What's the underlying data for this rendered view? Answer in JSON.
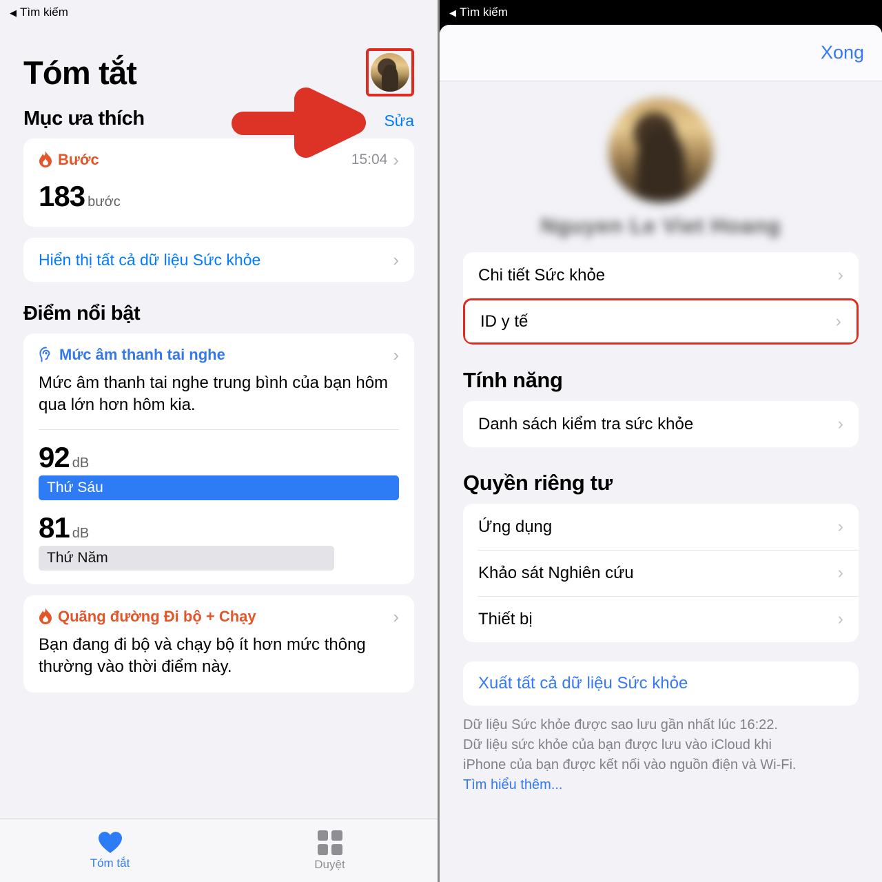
{
  "left": {
    "back_label": "Tìm kiếm",
    "title": "Tóm tắt",
    "avatar_icon": "user-avatar-photo",
    "arrow_icon": "red-pointer-arrow",
    "favorites": {
      "heading": "Mục ưa thích",
      "edit_label": "Sửa",
      "steps_card": {
        "icon": "flame-icon",
        "metric": "Bước",
        "time": "15:04",
        "value": "183",
        "unit": "bước"
      },
      "show_all_label": "Hiển thị tất cả dữ liệu Sức khỏe"
    },
    "highlights": {
      "heading": "Điểm nổi bật",
      "cards": [
        {
          "icon": "ear-icon",
          "metric": "Mức âm thanh tai nghe",
          "description": "Mức âm thanh tai nghe trung bình của bạn hôm qua lớn hơn hôm kia.",
          "bars": [
            {
              "value": "92",
              "unit": "dB",
              "label": "Thứ Sáu",
              "style": "blue",
              "width_pct": 100
            },
            {
              "value": "81",
              "unit": "dB",
              "label": "Thứ Năm",
              "style": "gray",
              "width_pct": 82
            }
          ]
        },
        {
          "icon": "flame-icon",
          "metric": "Quãng đường Đi bộ + Chạy",
          "description": "Bạn đang đi bộ và chạy bộ ít hơn mức thông thường vào thời điểm này."
        }
      ]
    },
    "tabs": [
      {
        "label": "Tóm tắt",
        "icon": "heart-icon",
        "active": true
      },
      {
        "label": "Duyệt",
        "icon": "grid-squares-icon",
        "active": false
      }
    ]
  },
  "right": {
    "back_label": "Tìm kiếm",
    "done_label": "Xong",
    "avatar_icon": "user-avatar-photo-blurred",
    "user_name": "Nguyen Le Viet Hoang",
    "account_rows": [
      {
        "label": "Chi tiết Sức khỏe",
        "highlighted": false
      },
      {
        "label": "ID y tế",
        "highlighted": true
      }
    ],
    "features": {
      "heading": "Tính năng",
      "rows": [
        {
          "label": "Danh sách kiểm tra sức khỏe"
        }
      ]
    },
    "privacy": {
      "heading": "Quyền riêng tư",
      "rows": [
        {
          "label": "Ứng dụng"
        },
        {
          "label": "Khảo sát Nghiên cứu"
        },
        {
          "label": "Thiết bị"
        }
      ]
    },
    "export_label": "Xuất tất cả dữ liệu Sức khỏe",
    "footnote_line1": "Dữ liệu Sức khỏe được sao lưu gần nhất lúc 16:22.",
    "footnote_line2": "Dữ liệu sức khỏe của bạn được lưu vào iCloud khi",
    "footnote_line3": "iPhone của bạn được kết nối vào nguồn điện và Wi-Fi.",
    "footnote_link": "Tìm hiểu thêm..."
  },
  "colors": {
    "accent_blue": "#007aff",
    "orange": "#e2562a",
    "highlight_red": "#e02b20",
    "bar_blue": "#2d7cf6"
  }
}
